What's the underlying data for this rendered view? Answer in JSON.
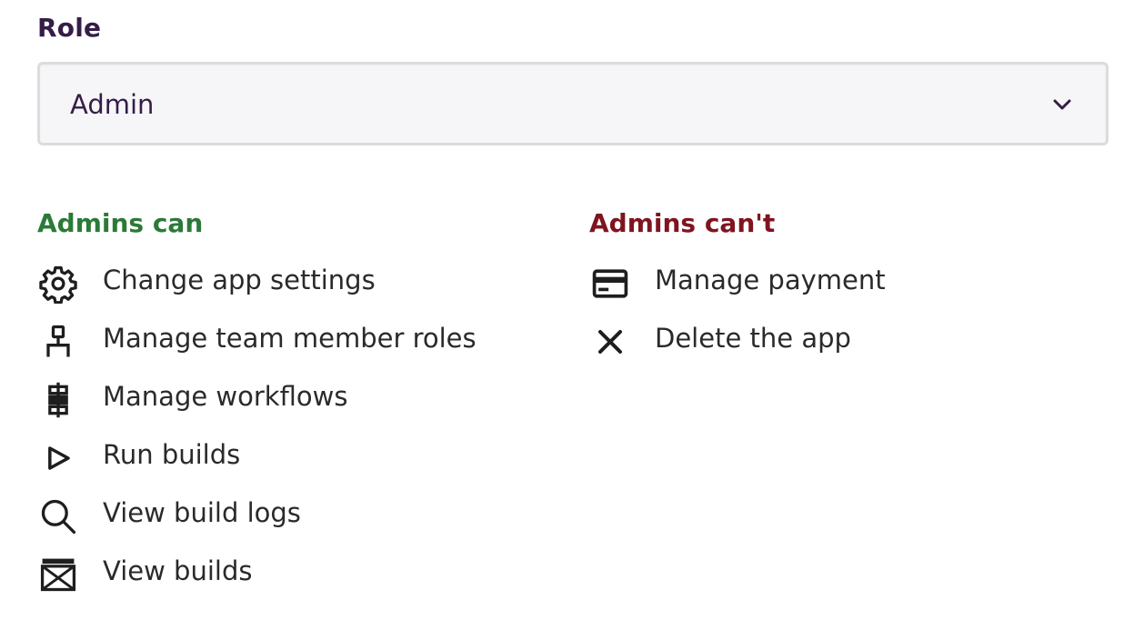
{
  "role": {
    "label": "Role",
    "selected_value": "Admin",
    "chevron_icon": "chevron-down-icon"
  },
  "permissions": {
    "can": {
      "title": "Admins can",
      "color": "#2b7a37",
      "items": [
        {
          "label": "Change app settings",
          "icon": "gear-icon"
        },
        {
          "label": "Manage team member roles",
          "icon": "person-icon"
        },
        {
          "label": "Manage workflows",
          "icon": "workflow-icon"
        },
        {
          "label": "Run builds",
          "icon": "play-icon"
        },
        {
          "label": "View build logs",
          "icon": "search-icon"
        },
        {
          "label": "View builds",
          "icon": "builds-icon"
        }
      ]
    },
    "cannot": {
      "title": "Admins can't",
      "color": "#7f1420",
      "items": [
        {
          "label": "Manage payment",
          "icon": "credit-card-icon"
        },
        {
          "label": "Delete the app",
          "icon": "close-icon"
        }
      ]
    }
  }
}
